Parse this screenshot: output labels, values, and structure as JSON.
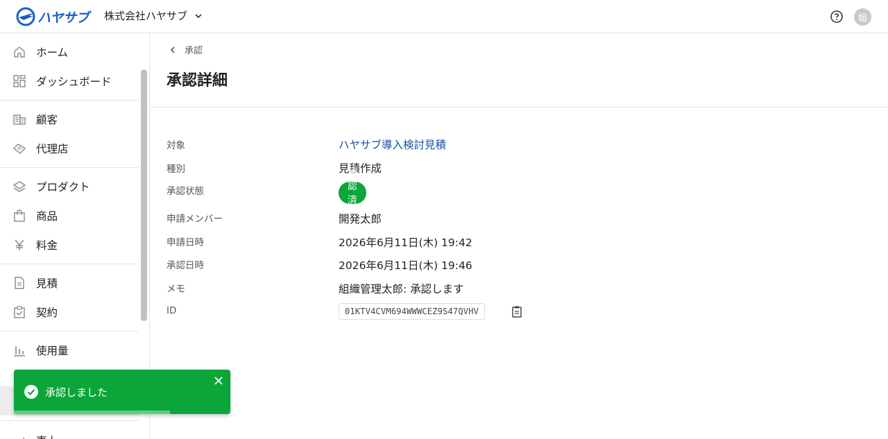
{
  "header": {
    "logo_text": "ハヤサブ",
    "org_name": "株式会社ハヤサブ",
    "avatar_text": "組"
  },
  "sidebar": {
    "groups": [
      [
        {
          "label": "ホーム",
          "icon": "home-icon"
        },
        {
          "label": "ダッシュボード",
          "icon": "dashboard-icon"
        }
      ],
      [
        {
          "label": "顧客",
          "icon": "building-icon"
        },
        {
          "label": "代理店",
          "icon": "handshake-icon"
        }
      ],
      [
        {
          "label": "プロダクト",
          "icon": "layers-icon"
        },
        {
          "label": "商品",
          "icon": "bag-icon"
        },
        {
          "label": "料金",
          "icon": "yen-icon"
        }
      ],
      [
        {
          "label": "見積",
          "icon": "document-icon"
        },
        {
          "label": "契約",
          "icon": "clipboard-check-icon"
        }
      ],
      [
        {
          "label": "使用量",
          "icon": "bar-chart-icon"
        }
      ]
    ],
    "partial_item_label": "売上"
  },
  "main": {
    "breadcrumb": "承認",
    "title": "承認詳細",
    "details": {
      "target_label": "対象",
      "target_value": "ハヤサブ導入検討見積",
      "type_label": "種別",
      "type_value": "見積作成",
      "status_label": "承認状態",
      "status_value": "承認済み",
      "applicant_label": "申請メンバー",
      "applicant_value": "開発太郎",
      "applied_at_label": "申請日時",
      "applied_at_value": "2026年6月11日(木) 19:42",
      "approved_at_label": "承認日時",
      "approved_at_value": "2026年6月11日(木) 19:46",
      "memo_label": "メモ",
      "memo_value": "組織管理太郎: 承認します",
      "id_label": "ID",
      "id_value": "01KTV4CVM694WWWCEZ9S47QVHV"
    }
  },
  "toast": {
    "message": "承認しました",
    "progress": 0.72
  },
  "colors": {
    "brand": "#1a5fc8",
    "link": "#1a4ea0",
    "success": "#0aa63a"
  }
}
